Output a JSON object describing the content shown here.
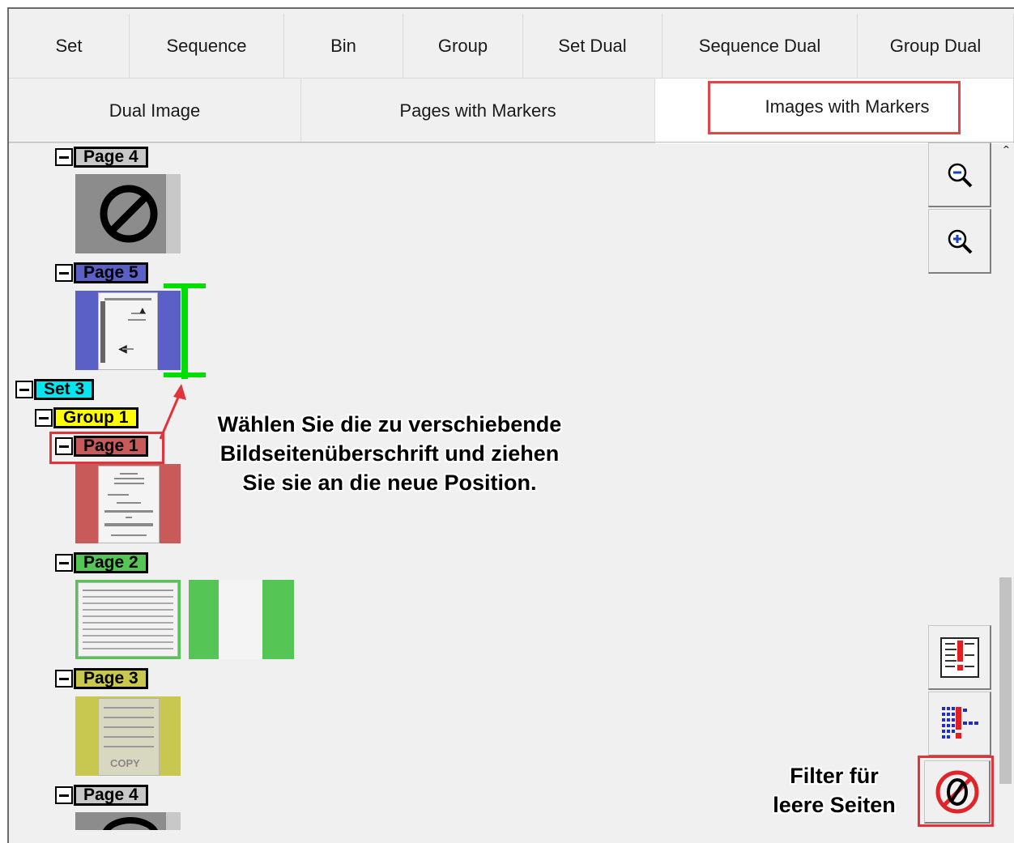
{
  "tabs_row1": [
    "Set",
    "Sequence",
    "Bin",
    "Group",
    "Set Dual",
    "Sequence Dual",
    "Group Dual"
  ],
  "tabs_row2": [
    "Dual Image",
    "Pages with Markers",
    "Images with Markers"
  ],
  "active_tab": "Images with Markers",
  "tree": {
    "page4_top": {
      "label": "Page 4",
      "color": "#c8c8c8"
    },
    "page5": {
      "label": "Page 5",
      "color": "#5b60c6"
    },
    "set3": {
      "label": "Set 3",
      "color": "#00e5ee"
    },
    "group1": {
      "label": "Group 1",
      "color": "#ffff00"
    },
    "page1": {
      "label": "Page 1",
      "color": "#c85a5a"
    },
    "page2": {
      "label": "Page 2",
      "color": "#55c655"
    },
    "page3": {
      "label": "Page 3",
      "color": "#c8c850"
    },
    "page4_bottom": {
      "label": "Page 4",
      "color": "#c8c8c8"
    }
  },
  "thumb_copy_text": "COPY",
  "annotation_drag": [
    "Wählen Sie die zu verschiebende",
    "Bildseitenüberschrift und ziehen",
    "Sie sie an die neue Position."
  ],
  "annotation_filter": [
    "Filter für",
    "leere Seiten"
  ],
  "tools": {
    "zoom_out": "zoom-out-icon",
    "zoom_in": "zoom-in-icon",
    "marker_list": "marker-list-icon",
    "marker_grid": "marker-grid-icon",
    "empty_filter": "empty-page-filter-icon"
  },
  "accent_colors": {
    "highlight_red": "#e0343a",
    "drop_indicator_green": "#00dd00"
  }
}
